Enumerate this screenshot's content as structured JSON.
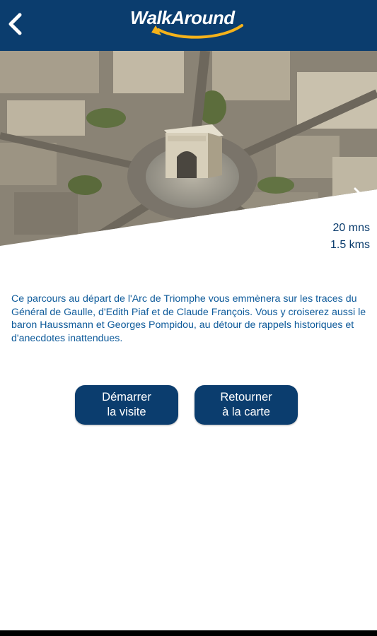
{
  "header": {
    "logo_text": "WalkAround"
  },
  "hero": {
    "image_subject": "Arc de Triomphe aerial view"
  },
  "route": {
    "duration": "20 mns",
    "distance": "1.5 kms",
    "description": "Ce parcours au départ de l'Arc de Triomphe vous emmènera sur les traces du Général de Gaulle, d'Edith Piaf et de Claude François. Vous y croiserez aussi le baron Haussmann et Georges Pompidou, au détour de rappels historiques et d'anecdotes inattendues."
  },
  "actions": {
    "start_line1": "Démarrer",
    "start_line2": "la visite",
    "return_line1": "Retourner",
    "return_line2": "à la carte"
  },
  "colors": {
    "brand": "#0b3d6e",
    "text_blue": "#0d5a9a",
    "logo_accent": "#f5b21a"
  },
  "icons": {
    "back": "chevron-left-icon",
    "next": "chevron-right-icon"
  }
}
